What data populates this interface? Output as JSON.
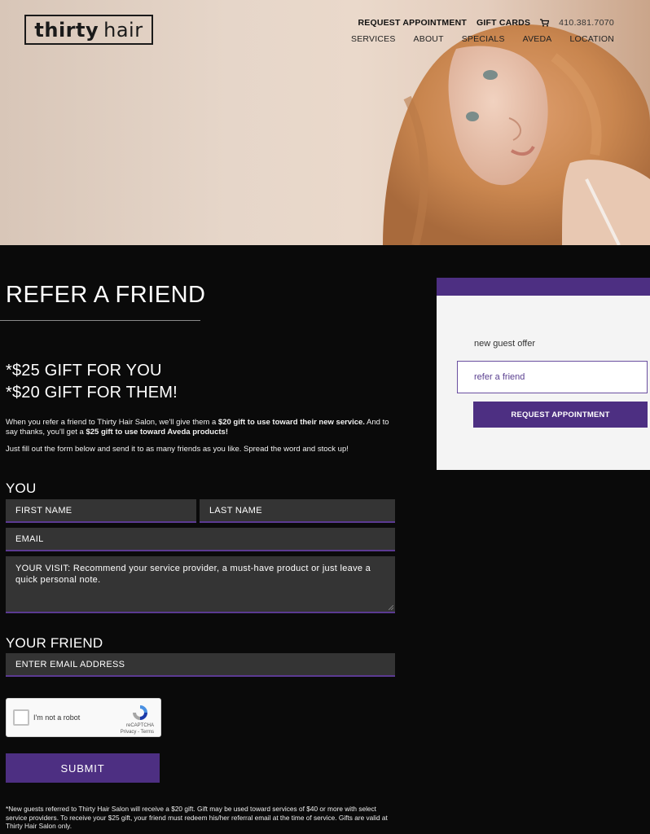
{
  "header": {
    "logo_text_bold": "thirty",
    "logo_text": "hair",
    "request_appointment": "REQUEST APPOINTMENT",
    "gift_cards": "GIFT CARDS",
    "phone": "410.381.7070",
    "nav": [
      "SERVICES",
      "ABOUT",
      "SPECIALS",
      "AVEDA",
      "LOCATION"
    ]
  },
  "main": {
    "title": "REFER A FRIEND",
    "gift_you": "*$25 GIFT FOR YOU",
    "gift_them": "*$20 GIFT FOR THEM!",
    "intro_a": "When you refer a friend to Thirty Hair Salon, we'll give them a ",
    "intro_b": "$20 gift to use toward their new service.",
    "intro_c": " And to say thanks, you'll get a ",
    "intro_d": "$25 gift to use toward Aveda products!",
    "intro2": "Just fill out the form below and send it to as many friends as you like. Spread the word and stock up!",
    "you_label": "YOU",
    "first_name": "FIRST NAME",
    "last_name": "LAST NAME",
    "email": "EMAIL",
    "visit": "YOUR VISIT: Recommend your service provider, a must-have product or just leave a quick personal note.",
    "friend_label": "YOUR FRIEND",
    "friend_email": "ENTER EMAIL ADDRESS",
    "captcha_text": "I'm not a robot",
    "captcha_brand": "reCAPTCHA",
    "captcha_links": "Privacy - Terms",
    "submit": "SUBMIT",
    "fineprint": "*New guests referred to Thirty Hair Salon will receive a $20 gift. Gift may be used toward services of $40 or more with select service providers. To receive your $25 gift, your friend must redeem his/her referral email at the time of service. Gifts are valid at Thirty Hair Salon only."
  },
  "widget": {
    "offer": "new guest offer",
    "select_value": "refer a friend",
    "button": "REQUEST APPOINTMENT"
  },
  "colors": {
    "accent": "#4d2f82",
    "background": "#0a0a0a",
    "field_bg": "#343434"
  }
}
